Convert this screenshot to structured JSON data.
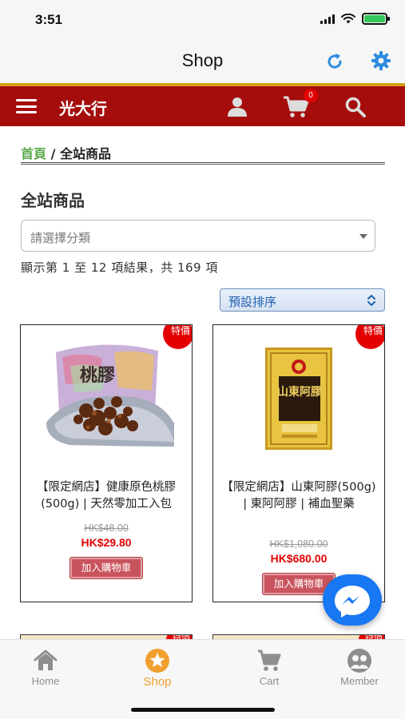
{
  "status_bar": {
    "time": "3:51"
  },
  "nav_header": {
    "title": "Shop",
    "refresh_icon": "refresh-icon",
    "settings_icon": "gear-icon",
    "accent_color": "#2e8be0"
  },
  "site_bar": {
    "name": "光大行",
    "cart_count": "0",
    "brand_color": "#a50c0c"
  },
  "breadcrumb": {
    "home": "首頁",
    "separator": "/",
    "current": "全站商品"
  },
  "page_title": "全站商品",
  "category_select": {
    "placeholder": "請選擇分類"
  },
  "result_count": "顯示第 1 至 12 項結果，共 169 項",
  "sort_select": {
    "selected": "預設排序"
  },
  "products": [
    {
      "badge": "特價",
      "name": "【限定網店】健康原色桃膠(500g) | 天然零加工入包",
      "image_label": "桃膠",
      "price_old": "HK$48.00",
      "price_new": "HK$29.80",
      "button": "加入購物車"
    },
    {
      "badge": "特價",
      "name": "【限定網店】山東阿膠(500g) | 東阿阿膠 | 補血聖藥",
      "image_label": "山東阿膠",
      "price_old": "HK$1,080.00",
      "price_new": "HK$680.00",
      "button": "加入購物車"
    }
  ],
  "next_row_badges": [
    "特價",
    "特價"
  ],
  "tabs": [
    {
      "label": "Home",
      "icon": "home-icon"
    },
    {
      "label": "Shop",
      "icon": "star-icon",
      "active": true
    },
    {
      "label": "Cart",
      "icon": "cart-icon"
    },
    {
      "label": "Member",
      "icon": "member-icon"
    }
  ]
}
